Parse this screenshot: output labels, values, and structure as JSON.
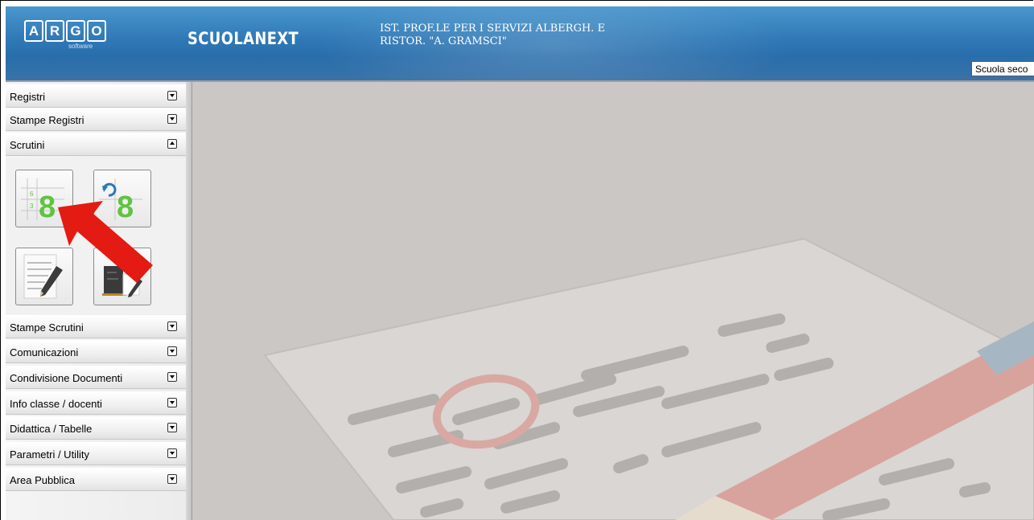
{
  "header": {
    "logo_letters": [
      "A",
      "R",
      "G",
      "O"
    ],
    "logo_sub": "software",
    "brand": "SCUOLANEXT",
    "school_line1": "IST. PROF.LE PER I SERVIZI ALBERGH. E",
    "school_line2": "RISTOR. \"A. GRAMSCI\"",
    "school_select": "Scuola seco"
  },
  "sidebar": {
    "items": [
      {
        "label": "Registri",
        "state": "collapsed"
      },
      {
        "label": "Stampe Registri",
        "state": "collapsed"
      },
      {
        "label": "Scrutini",
        "state": "expanded"
      },
      {
        "label": "Stampe Scrutini",
        "state": "collapsed"
      },
      {
        "label": "Comunicazioni",
        "state": "collapsed"
      },
      {
        "label": "Condivisione Documenti",
        "state": "collapsed"
      },
      {
        "label": "Info classe / docenti",
        "state": "collapsed"
      },
      {
        "label": "Didattica / Tabelle",
        "state": "collapsed"
      },
      {
        "label": "Parametri / Utility",
        "state": "collapsed"
      },
      {
        "label": "Area Pubblica",
        "state": "collapsed"
      }
    ],
    "scrutini_tools": [
      {
        "icon": "grades-grid-icon",
        "digits": [
          "6",
          "3",
          "8"
        ]
      },
      {
        "icon": "refresh-grades-icon",
        "digits": [
          "8"
        ]
      },
      {
        "icon": "edit-document-icon"
      },
      {
        "icon": "edit-board-icon"
      }
    ]
  },
  "colors": {
    "header_blue": "#2f78b6",
    "grade_green": "#5fc43f",
    "arrow_red": "#e31b12",
    "main_bg": "#cbc7c4"
  }
}
